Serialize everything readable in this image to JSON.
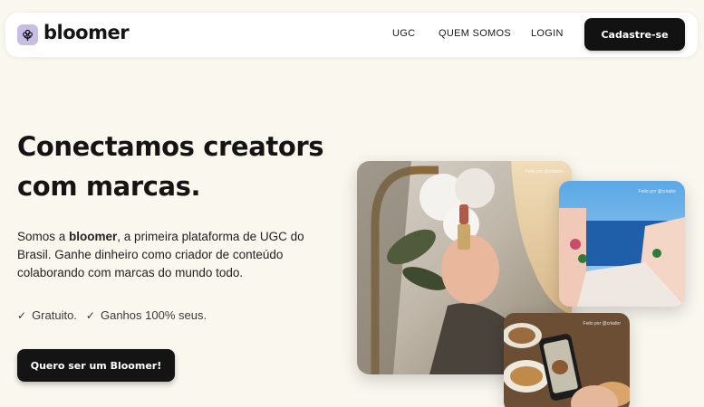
{
  "brand": {
    "name": "bloomer",
    "accent": "#c7bde8"
  },
  "nav": {
    "links": [
      "UGC",
      "QUEM SOMOS",
      "LOGIN"
    ],
    "cta": "Cadastre-se"
  },
  "hero": {
    "title_line1": "Conectamos creators",
    "title_line2": "com marcas.",
    "desc_pre": "Somos a ",
    "desc_brand": "bloomer",
    "desc_post": ", a primeira plataforma de UGC do Brasil. Ganhe dinheiro como criador de conteúdo colaborando com marcas do mundo todo.",
    "features": [
      "Gratuito.",
      "Ganhos 100% seus."
    ],
    "cta": "Quero ser um Bloomer!"
  },
  "images": {
    "tag": "Feito por @criador"
  }
}
